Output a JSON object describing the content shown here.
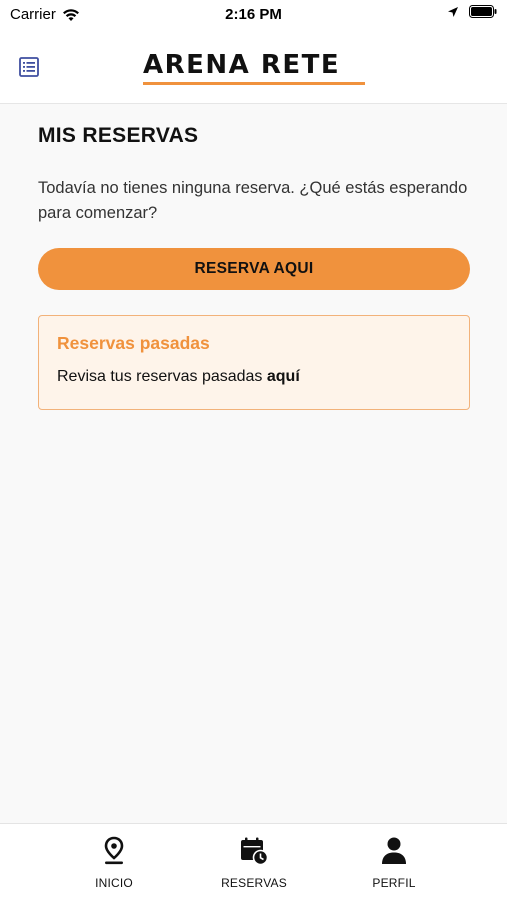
{
  "status_bar": {
    "carrier": "Carrier",
    "time": "2:16 PM",
    "icons": [
      "wifi-icon",
      "location-arrow-icon",
      "battery-icon"
    ]
  },
  "header": {
    "logo_text": "ARENA RETE",
    "menu_icon": "list-menu-icon",
    "accent_color": "#f0923d"
  },
  "main": {
    "title": "MIS RESERVAS",
    "empty_message": "Todavía no tienes ninguna reserva. ¿Qué estás esperando para comenzar?",
    "cta_label": "RESERVA AQUI",
    "past_card": {
      "title": "Reservas pasadas",
      "text": "Revisa tus reservas pasadas ",
      "link": "aquí"
    }
  },
  "tabbar": {
    "tabs": [
      {
        "label": "INICIO",
        "icon": "location-pin-icon"
      },
      {
        "label": "RESERVAS",
        "icon": "calendar-clock-icon"
      },
      {
        "label": "PERFIL",
        "icon": "user-icon"
      }
    ]
  }
}
